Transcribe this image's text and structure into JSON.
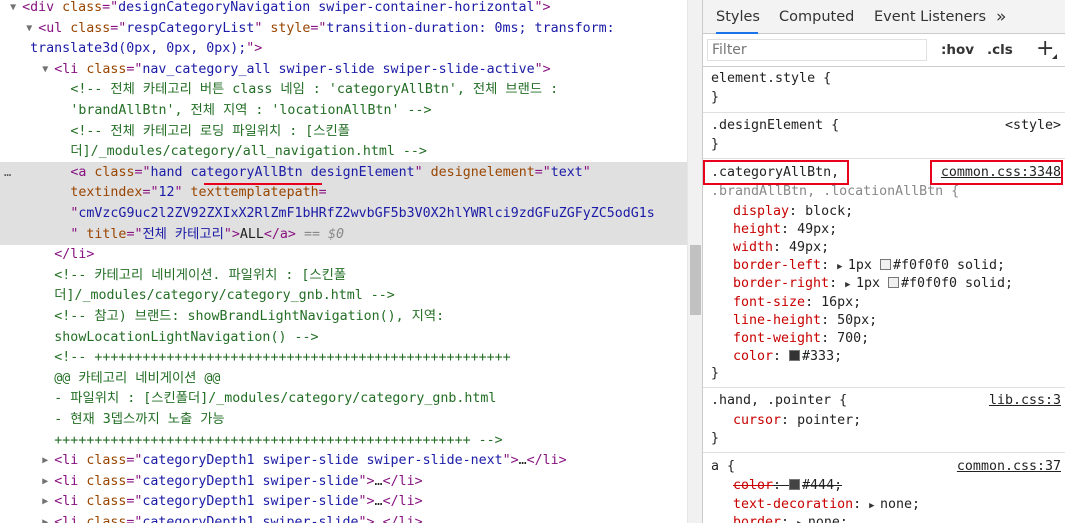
{
  "dom": {
    "lines": [
      {
        "indent": 2,
        "arrow": "▼",
        "parts": [
          [
            "tag",
            "<div "
          ],
          [
            "attr",
            "class"
          ],
          [
            "tag",
            "=\""
          ],
          [
            "val",
            "designCategoryNavigation swiper-container-horizontal"
          ],
          [
            "tag",
            "\">"
          ]
        ]
      },
      {
        "indent": 4,
        "arrow": "▼",
        "parts": [
          [
            "tag",
            "<ul "
          ],
          [
            "attr",
            "class"
          ],
          [
            "tag",
            "=\""
          ],
          [
            "val",
            "respCategoryList"
          ],
          [
            "tag",
            "\" "
          ],
          [
            "attr",
            "style"
          ],
          [
            "tag",
            "=\""
          ],
          [
            "val",
            "transition-duration: 0ms; transform:"
          ]
        ]
      },
      {
        "indent": 3,
        "arrow": "",
        "parts": [
          [
            "val",
            "translate3d(0px, 0px, 0px);"
          ],
          [
            "tag",
            "\">"
          ]
        ]
      },
      {
        "indent": 6,
        "arrow": "▼",
        "parts": [
          [
            "tag",
            "<li "
          ],
          [
            "attr",
            "class"
          ],
          [
            "tag",
            "=\""
          ],
          [
            "val",
            "nav_category_all swiper-slide swiper-slide-active"
          ],
          [
            "tag",
            "\">"
          ]
        ]
      },
      {
        "indent": 8,
        "arrow": "",
        "parts": [
          [
            "cmt",
            "<!-- 전체 카테고리 버튼 class 네임 : 'categoryAllBtn', 전체 브랜드 :"
          ]
        ]
      },
      {
        "indent": 8,
        "arrow": "",
        "parts": [
          [
            "cmt",
            "'brandAllBtn', 전체 지역 : 'locationAllBtn' -->"
          ]
        ]
      },
      {
        "indent": 8,
        "arrow": "",
        "parts": [
          [
            "cmt",
            "<!-- 전체 카테고리 로딩 파일위치 : [스킨폴"
          ]
        ]
      },
      {
        "indent": 8,
        "arrow": "",
        "parts": [
          [
            "cmt",
            "더]/_modules/category/all_navigation.html -->"
          ]
        ]
      },
      {
        "indent": 8,
        "arrow": "",
        "sel": true,
        "parts": [
          [
            "tag",
            "<a "
          ],
          [
            "attr",
            "class"
          ],
          [
            "tag",
            "=\""
          ],
          [
            "val",
            "hand categoryAllBtn designElement"
          ],
          [
            "tag",
            "\" "
          ],
          [
            "attr",
            "designelement"
          ],
          [
            "tag",
            "=\""
          ],
          [
            "val",
            "text"
          ],
          [
            "tag",
            "\""
          ]
        ]
      },
      {
        "indent": 8,
        "arrow": "",
        "sel": true,
        "parts": [
          [
            "attr",
            "textindex"
          ],
          [
            "tag",
            "=\""
          ],
          [
            "val",
            "12"
          ],
          [
            "tag",
            "\" "
          ],
          [
            "attr",
            "texttemplatepath"
          ],
          [
            "tag",
            "="
          ]
        ]
      },
      {
        "indent": 8,
        "arrow": "",
        "sel": true,
        "parts": [
          [
            "tag",
            "\""
          ],
          [
            "val",
            "cmVzcG9uc2l2ZV92ZXIxX2RlZmF1bHRfZ2wvbGF5b3V0X2hlYWRlci9zdGFuZGFyZC5odG1s"
          ]
        ]
      },
      {
        "indent": 8,
        "arrow": "",
        "sel": true,
        "parts": [
          [
            "tag",
            "\" "
          ],
          [
            "attr",
            "title"
          ],
          [
            "tag",
            "=\""
          ],
          [
            "val",
            "전체 카테고리"
          ],
          [
            "tag",
            "\">"
          ],
          [
            "txt",
            "ALL"
          ],
          [
            "tag",
            "</a>"
          ],
          [
            "dim",
            " == $0"
          ]
        ]
      },
      {
        "indent": 6,
        "arrow": "",
        "parts": [
          [
            "tag",
            "</li>"
          ]
        ]
      },
      {
        "indent": 6,
        "arrow": "",
        "parts": [
          [
            "cmt",
            "<!-- 카테고리 네비게이션. 파일위치 : [스킨폴"
          ]
        ]
      },
      {
        "indent": 6,
        "arrow": "",
        "parts": [
          [
            "cmt",
            "더]/_modules/category/category_gnb.html -->"
          ]
        ]
      },
      {
        "indent": 6,
        "arrow": "",
        "parts": [
          [
            "cmt",
            "<!-- 참고) 브랜드: showBrandLightNavigation(), 지역:"
          ]
        ]
      },
      {
        "indent": 6,
        "arrow": "",
        "parts": [
          [
            "cmt",
            "showLocationLightNavigation() -->"
          ]
        ]
      },
      {
        "indent": 6,
        "arrow": "",
        "parts": [
          [
            "cmt",
            "<!-- ++++++++++++++++++++++++++++++++++++++++++++++++++++"
          ]
        ]
      },
      {
        "indent": 6,
        "arrow": "",
        "parts": [
          [
            "cmt",
            "@@ 카테고리 네비게이션 @@"
          ]
        ]
      },
      {
        "indent": 6,
        "arrow": "",
        "parts": [
          [
            "cmt",
            "- 파일위치 : [스킨폴더]/_modules/category/category_gnb.html"
          ]
        ]
      },
      {
        "indent": 6,
        "arrow": "",
        "parts": [
          [
            "cmt",
            "- 현재 3뎁스까지 노출 가능"
          ]
        ]
      },
      {
        "indent": 6,
        "arrow": "",
        "parts": [
          [
            "cmt",
            "++++++++++++++++++++++++++++++++++++++++++++++++++++ -->"
          ]
        ]
      },
      {
        "indent": 6,
        "arrow": "▶",
        "parts": [
          [
            "tag",
            "<li "
          ],
          [
            "attr",
            "class"
          ],
          [
            "tag",
            "=\""
          ],
          [
            "val",
            "categoryDepth1 swiper-slide swiper-slide-next"
          ],
          [
            "tag",
            "\">"
          ],
          [
            "txt",
            "…"
          ],
          [
            "tag",
            "</li>"
          ]
        ]
      },
      {
        "indent": 6,
        "arrow": "▶",
        "parts": [
          [
            "tag",
            "<li "
          ],
          [
            "attr",
            "class"
          ],
          [
            "tag",
            "=\""
          ],
          [
            "val",
            "categoryDepth1 swiper-slide"
          ],
          [
            "tag",
            "\">"
          ],
          [
            "txt",
            "…"
          ],
          [
            "tag",
            "</li>"
          ]
        ]
      },
      {
        "indent": 6,
        "arrow": "▶",
        "parts": [
          [
            "tag",
            "<li "
          ],
          [
            "attr",
            "class"
          ],
          [
            "tag",
            "=\""
          ],
          [
            "val",
            "categoryDepth1 swiper-slide"
          ],
          [
            "tag",
            "\">"
          ],
          [
            "txt",
            "…"
          ],
          [
            "tag",
            "</li>"
          ]
        ]
      },
      {
        "indent": 6,
        "arrow": "▶",
        "parts": [
          [
            "tag",
            "<li "
          ],
          [
            "attr",
            "class"
          ],
          [
            "tag",
            "=\""
          ],
          [
            "val",
            "categoryDepth1 swiper-slide"
          ],
          [
            "tag",
            "\">"
          ],
          [
            "txt",
            "…"
          ],
          [
            "tag",
            "</li>"
          ]
        ]
      }
    ],
    "ellipsis": "…"
  },
  "styles_panel": {
    "tabs": [
      "Styles",
      "Computed",
      "Event Listeners",
      "»"
    ],
    "filter_placeholder": "Filter",
    "hov": ":hov",
    "cls": ".cls",
    "plus": "+",
    "element_style": {
      "selector": "element.style {",
      "close": "}"
    },
    "design_element": {
      "selector": ".designElement {",
      "source": "<style>",
      "close": "}"
    },
    "category_rule": {
      "selector_first": ".categoryAllBtn,",
      "selector_rest": ".brandAllBtn, .locationAllBtn {",
      "source": "common.css:3348",
      "props": [
        {
          "name": "display",
          "value": "block;"
        },
        {
          "name": "height",
          "value": "49px;"
        },
        {
          "name": "width",
          "value": "49px;"
        },
        {
          "name": "border-left",
          "value": "1px",
          "swatch": "#f0f0f0",
          "rest": "#f0f0f0 solid;",
          "tri": true
        },
        {
          "name": "border-right",
          "value": "1px",
          "swatch": "#f0f0f0",
          "rest": "#f0f0f0 solid;",
          "tri": true
        },
        {
          "name": "font-size",
          "value": "16px;"
        },
        {
          "name": "line-height",
          "value": "50px;"
        },
        {
          "name": "font-weight",
          "value": "700;"
        },
        {
          "name": "color",
          "value": "",
          "swatch": "#333333",
          "rest": "#333;"
        }
      ],
      "close": "}"
    },
    "hand_rule": {
      "selector": ".hand, .pointer {",
      "source": "lib.css:3",
      "props": [
        {
          "name": "cursor",
          "value": "pointer;"
        }
      ],
      "close": "}"
    },
    "a_rule": {
      "selector": "a {",
      "source": "common.css:37",
      "props": [
        {
          "name": "color",
          "swatch": "#444444",
          "rest": "#444;",
          "struck": true
        },
        {
          "name": "text-decoration",
          "value": "none;",
          "tri": true
        },
        {
          "name": "border",
          "value": "none;",
          "tri": true
        }
      ]
    }
  }
}
